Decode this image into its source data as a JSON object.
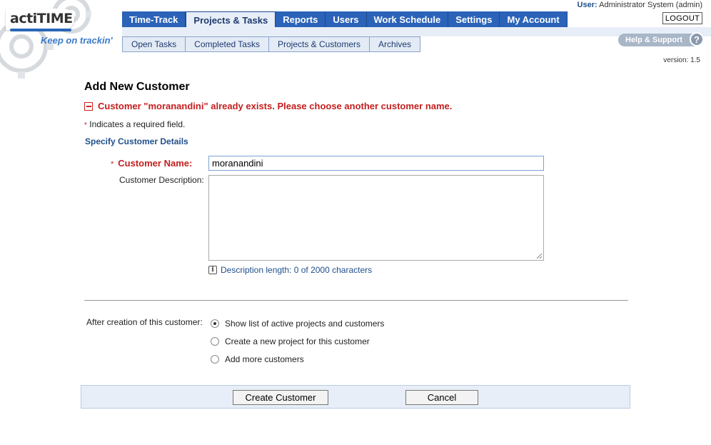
{
  "header": {
    "logo_text": "actiTIME",
    "tagline": "Keep on trackin'",
    "user_label": "User:",
    "user_name": "Administrator System (admin)",
    "logout_label": "LOGOUT",
    "help_label": "Help & Support",
    "help_icon_glyph": "?",
    "version": "version: 1.5"
  },
  "top_nav": [
    {
      "label": "Time-Track",
      "active": false
    },
    {
      "label": "Projects & Tasks",
      "active": true
    },
    {
      "label": "Reports",
      "active": false
    },
    {
      "label": "Users",
      "active": false
    },
    {
      "label": "Work Schedule",
      "active": false
    },
    {
      "label": "Settings",
      "active": false
    },
    {
      "label": "My Account",
      "active": false
    }
  ],
  "sub_nav": [
    {
      "label": "Open Tasks"
    },
    {
      "label": "Completed Tasks"
    },
    {
      "label": "Projects & Customers"
    },
    {
      "label": "Archives"
    }
  ],
  "form": {
    "title": "Add New Customer",
    "error": "Customer \"moranandini\" already exists. Please choose another customer name.",
    "required_star": "*",
    "required_note": " Indicates a required field.",
    "section_title": "Specify Customer Details",
    "name_label": "Customer Name:",
    "name_value": "moranandini",
    "description_label": "Customer Description:",
    "description_value": "",
    "description_length": "Description length: 0 of 2000 characters",
    "info_icon_glyph": "i",
    "after_label": "After creation of this customer:",
    "options": [
      {
        "label": "Show list of active projects and customers",
        "checked": true
      },
      {
        "label": "Create a new project for this customer",
        "checked": false
      },
      {
        "label": "Add more customers",
        "checked": false
      }
    ],
    "create_button": "Create Customer",
    "cancel_button": "Cancel"
  },
  "colors": {
    "nav_blue": "#2a63b8",
    "error_red": "#c41e1e",
    "link_blue": "#1f4f8c",
    "panel_bg": "#e8eef7"
  }
}
